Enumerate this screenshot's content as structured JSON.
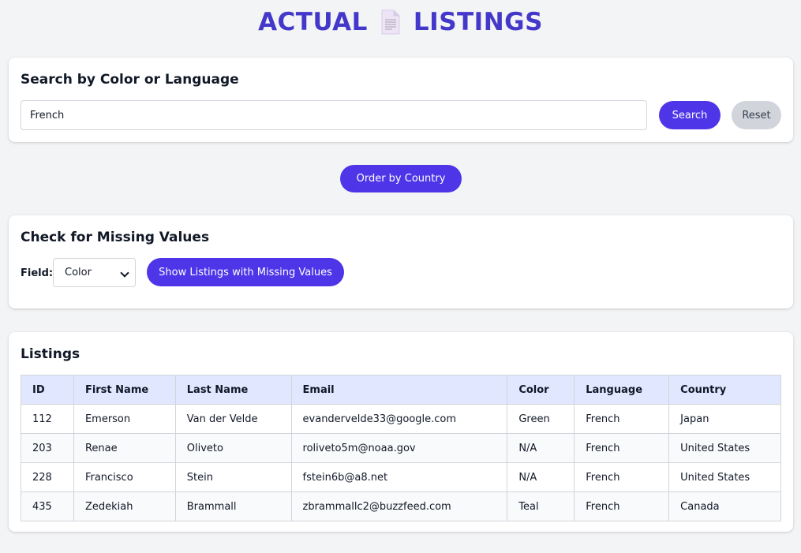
{
  "header": {
    "title_left": "ACTUAL",
    "title_right": "LISTINGS",
    "icon": "document-icon"
  },
  "search": {
    "heading": "Search by Color or Language",
    "input_value": "French",
    "search_label": "Search",
    "reset_label": "Reset"
  },
  "order": {
    "label": "Order by Country"
  },
  "missing": {
    "heading": "Check for Missing Values",
    "field_label": "Field:",
    "field_selected": "Color",
    "button_label": "Show Listings with Missing Values"
  },
  "listings": {
    "heading": "Listings",
    "columns": [
      "ID",
      "First Name",
      "Last Name",
      "Email",
      "Color",
      "Language",
      "Country"
    ],
    "rows": [
      [
        "112",
        "Emerson",
        "Van der Velde",
        "evandervelde33@google.com",
        "Green",
        "French",
        "Japan"
      ],
      [
        "203",
        "Renae",
        "Oliveto",
        "roliveto5m@noaa.gov",
        "N/A",
        "French",
        "United States"
      ],
      [
        "228",
        "Francisco",
        "Stein",
        "fstein6b@a8.net",
        "N/A",
        "French",
        "United States"
      ],
      [
        "435",
        "Zedekiah",
        "Brammall",
        "zbrammallc2@buzzfeed.com",
        "Teal",
        "French",
        "Canada"
      ]
    ]
  },
  "colors": {
    "accent": "#4f35e8",
    "title": "#4338ca",
    "header_row": "#e0e7ff"
  }
}
